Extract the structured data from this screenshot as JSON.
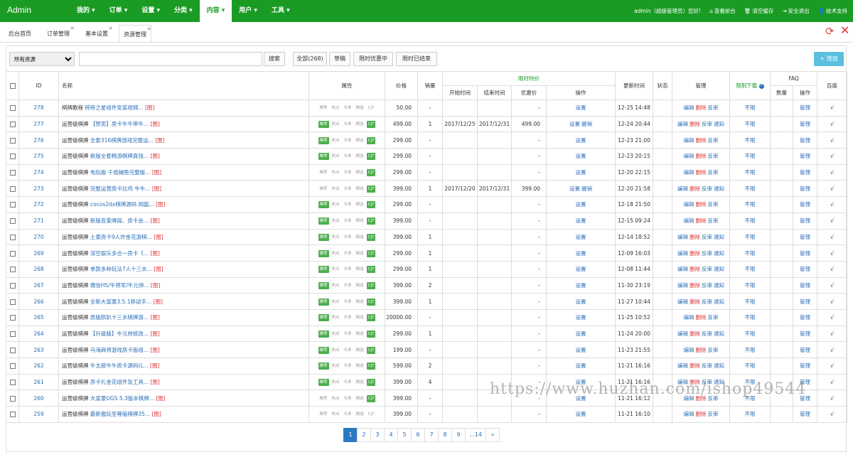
{
  "navbar": {
    "brand": "Admin",
    "menu": [
      {
        "label": "我的 ▾",
        "active": false
      },
      {
        "label": "订单 ▾",
        "active": false
      },
      {
        "label": "设置 ▾",
        "active": false
      },
      {
        "label": "分类 ▾",
        "active": false
      },
      {
        "label": "内容 ▾",
        "active": true
      },
      {
        "label": "用户 ▾",
        "active": false
      },
      {
        "label": "工具 ▾",
        "active": false
      }
    ],
    "right": [
      {
        "icon": "",
        "label": "admin（超级管理员）您好!"
      },
      {
        "icon": "home-icon",
        "label": "查看前台"
      },
      {
        "icon": "trash-icon",
        "label": "清空缓存"
      },
      {
        "icon": "logout-icon",
        "label": "安全退出"
      },
      {
        "icon": "user-icon",
        "label": "技术支持"
      }
    ]
  },
  "tabs": [
    {
      "label": "后台首页",
      "closable": false,
      "active": false
    },
    {
      "label": "订单管理",
      "closable": true,
      "active": false
    },
    {
      "label": "基本设置",
      "closable": true,
      "active": false
    },
    {
      "label": "资源管理",
      "closable": true,
      "active": true
    }
  ],
  "toolbar": {
    "select_value": "所有资源",
    "search_placeholder": "",
    "search_button": "搜索",
    "filters": [
      "全部(268)",
      "草稿",
      "限时优惠中",
      "限时已结束"
    ],
    "add_button": "+ 增加"
  },
  "table": {
    "headers": {
      "id": "ID",
      "name": "名称",
      "attr": "属性",
      "price": "价格",
      "sales": "销量",
      "limit_group": "限时特价",
      "start": "开始时间",
      "end": "结束时间",
      "discount": "优惠价",
      "op": "操作",
      "updated": "更新时间",
      "status": "状态",
      "manage": "管理",
      "limit_dl": "限制下载",
      "faq_group": "FAQ",
      "faq_count": "数量",
      "faq_op": "操作",
      "baidu": "百度"
    },
    "badge_labels": [
      "推荐",
      "热点",
      "头条",
      "精选",
      "CJT"
    ],
    "edit_label": "设置",
    "cancel_label": "撤销",
    "manage_edit": "编辑",
    "manage_delete": "删除",
    "manage_review": "反审",
    "manage_notify": "通知",
    "limit_text": "不限",
    "faq_manage": "管理",
    "check_mark": "√",
    "image_tag": "[图]",
    "rows": [
      {
        "id": "278",
        "cat": "棋牌教程",
        "title": "砖砖之星组件安装视频...",
        "badges": [
          0,
          0,
          0,
          0,
          0
        ],
        "price": "50.00",
        "sales": "-",
        "start": "",
        "end": "",
        "discount": "-",
        "cancel": false,
        "updated": "12-25 14:48",
        "notify": false
      },
      {
        "id": "277",
        "cat": "运营级棋牌",
        "title": "【赞卖】房卡牛牛带牛...",
        "badges": [
          1,
          0,
          0,
          0,
          1
        ],
        "price": "499.00",
        "sales": "1",
        "start": "2017/12/25",
        "end": "2017/12/31",
        "discount": "499.00",
        "cancel": true,
        "updated": "12-24 20:44",
        "notify": true
      },
      {
        "id": "276",
        "cat": "运营级棋牌",
        "title": "全套316棋牌游戏完整运...",
        "badges": [
          1,
          0,
          0,
          0,
          1
        ],
        "price": "299.00",
        "sales": "-",
        "start": "",
        "end": "",
        "discount": "-",
        "cancel": false,
        "updated": "12-23 21:00",
        "notify": false
      },
      {
        "id": "275",
        "cat": "运营级棋牌",
        "title": "新版全套畅游棋牌真钱...",
        "badges": [
          1,
          0,
          0,
          0,
          1
        ],
        "price": "299.00",
        "sales": "-",
        "start": "",
        "end": "",
        "discount": "-",
        "cancel": false,
        "updated": "12-23 20:15",
        "notify": false
      },
      {
        "id": "274",
        "cat": "运营级棋牌",
        "title": "电玩版 千炮捕鱼完整版...",
        "badges": [
          0,
          0,
          0,
          0,
          1
        ],
        "price": "299.00",
        "sales": "-",
        "start": "",
        "end": "",
        "discount": "-",
        "cancel": false,
        "updated": "12-20 22:15",
        "notify": false
      },
      {
        "id": "273",
        "cat": "运营级棋牌",
        "title": "完整运营房卡比鸡 牛牛...",
        "badges": [
          0,
          0,
          0,
          0,
          1
        ],
        "price": "399.00",
        "sales": "1",
        "start": "2017/12/20",
        "end": "2017/12/31",
        "discount": "399.00",
        "cancel": true,
        "updated": "12-20 21:58",
        "notify": true
      },
      {
        "id": "272",
        "cat": "运营级棋牌",
        "title": "cocos2dx棋牌源码 网狐...",
        "badges": [
          1,
          0,
          0,
          0,
          1
        ],
        "price": "299.00",
        "sales": "-",
        "start": "",
        "end": "",
        "discount": "-",
        "cancel": false,
        "updated": "12-18 21:50",
        "notify": false
      },
      {
        "id": "271",
        "cat": "运营级棋牌",
        "title": "新版吾爱牌局、房卡会...",
        "badges": [
          1,
          0,
          0,
          0,
          1
        ],
        "price": "399.00",
        "sales": "-",
        "start": "",
        "end": "",
        "discount": "-",
        "cancel": false,
        "updated": "12-15 09:24",
        "notify": false
      },
      {
        "id": "270",
        "cat": "运营级棋牌",
        "title": "土豪房卡9人炸金花游棋...",
        "badges": [
          1,
          0,
          0,
          0,
          1
        ],
        "price": "399.00",
        "sales": "1",
        "start": "",
        "end": "",
        "discount": "-",
        "cancel": false,
        "updated": "12-14 18:52",
        "notify": true
      },
      {
        "id": "269",
        "cat": "运营级棋牌",
        "title": "深空娱乐多合一房卡《...",
        "badges": [
          1,
          0,
          0,
          0,
          1
        ],
        "price": "299.00",
        "sales": "1",
        "start": "",
        "end": "",
        "discount": "-",
        "cancel": false,
        "updated": "12-09 16:03",
        "notify": true
      },
      {
        "id": "268",
        "cat": "运营级棋牌",
        "title": "单款多种玩法7人十三水...",
        "badges": [
          1,
          0,
          0,
          0,
          1
        ],
        "price": "299.00",
        "sales": "1",
        "start": "",
        "end": "",
        "discount": "-",
        "cancel": false,
        "updated": "12-08 11:44",
        "notify": true
      },
      {
        "id": "267",
        "cat": "运营级棋牌",
        "title": "微信H5/牛将军/牛元帅...",
        "badges": [
          1,
          0,
          0,
          0,
          1
        ],
        "price": "399.00",
        "sales": "2",
        "start": "",
        "end": "",
        "discount": "-",
        "cancel": false,
        "updated": "11-30 23:19",
        "notify": true
      },
      {
        "id": "266",
        "cat": "运营级棋牌",
        "title": "全新大富豪3.5.1移动手...",
        "badges": [
          1,
          0,
          0,
          0,
          1
        ],
        "price": "399.00",
        "sales": "1",
        "start": "",
        "end": "",
        "discount": "-",
        "cancel": false,
        "updated": "11-27 10:44",
        "notify": true
      },
      {
        "id": "265",
        "cat": "运营级棋牌",
        "title": "原版拱趴十三水棋牌游...",
        "badges": [
          1,
          0,
          0,
          0,
          1
        ],
        "price": "20000.00",
        "sales": "-",
        "start": "",
        "end": "",
        "discount": "-",
        "cancel": false,
        "updated": "11-25 10:52",
        "notify": false
      },
      {
        "id": "264",
        "cat": "运营级棋牌",
        "title": "【升级版】牛元帅修改...",
        "badges": [
          1,
          0,
          0,
          0,
          1
        ],
        "price": "299.00",
        "sales": "1",
        "start": "",
        "end": "",
        "discount": "-",
        "cancel": false,
        "updated": "11-24 20:00",
        "notify": true
      },
      {
        "id": "263",
        "cat": "运营级棋牌",
        "title": "乌海麻将游戏房卡版组...",
        "badges": [
          1,
          0,
          0,
          0,
          1
        ],
        "price": "199.00",
        "sales": "-",
        "start": "",
        "end": "",
        "discount": "-",
        "cancel": false,
        "updated": "11-23 21:55",
        "notify": false
      },
      {
        "id": "262",
        "cat": "运营级棋牌",
        "title": "牛太郎牛牛房卡源码(L...",
        "badges": [
          1,
          0,
          0,
          0,
          1
        ],
        "price": "599.00",
        "sales": "2",
        "start": "",
        "end": "",
        "discount": "-",
        "cancel": false,
        "updated": "11-21 16:16",
        "notify": true
      },
      {
        "id": "261",
        "cat": "运营级棋牌",
        "title": "房卡扎金花组件及工具...",
        "badges": [
          1,
          0,
          0,
          0,
          1
        ],
        "price": "399.00",
        "sales": "4",
        "start": "",
        "end": "",
        "discount": "-",
        "cancel": false,
        "updated": "11-21 16:16",
        "notify": true
      },
      {
        "id": "260",
        "cat": "运营级棋牌",
        "title": "大富豪UGS 5.3版本棋牌...",
        "badges": [
          0,
          0,
          0,
          0,
          1
        ],
        "price": "399.00",
        "sales": "-",
        "start": "",
        "end": "",
        "discount": "-",
        "cancel": false,
        "updated": "11-21 16:12",
        "notify": false
      },
      {
        "id": "259",
        "cat": "运营级棋牌",
        "title": "最新傲玩至尊版棋牌35...",
        "badges": [
          0,
          0,
          0,
          0,
          0
        ],
        "price": "399.00",
        "sales": "-",
        "start": "",
        "end": "",
        "discount": "-",
        "cancel": false,
        "updated": "11-21 16:10",
        "notify": false
      }
    ]
  },
  "pagination": [
    "1",
    "2",
    "3",
    "4",
    "5",
    "6",
    "7",
    "8",
    "9",
    "...14",
    "»"
  ],
  "watermark": "https://www.huzhan.com/ishop49544"
}
